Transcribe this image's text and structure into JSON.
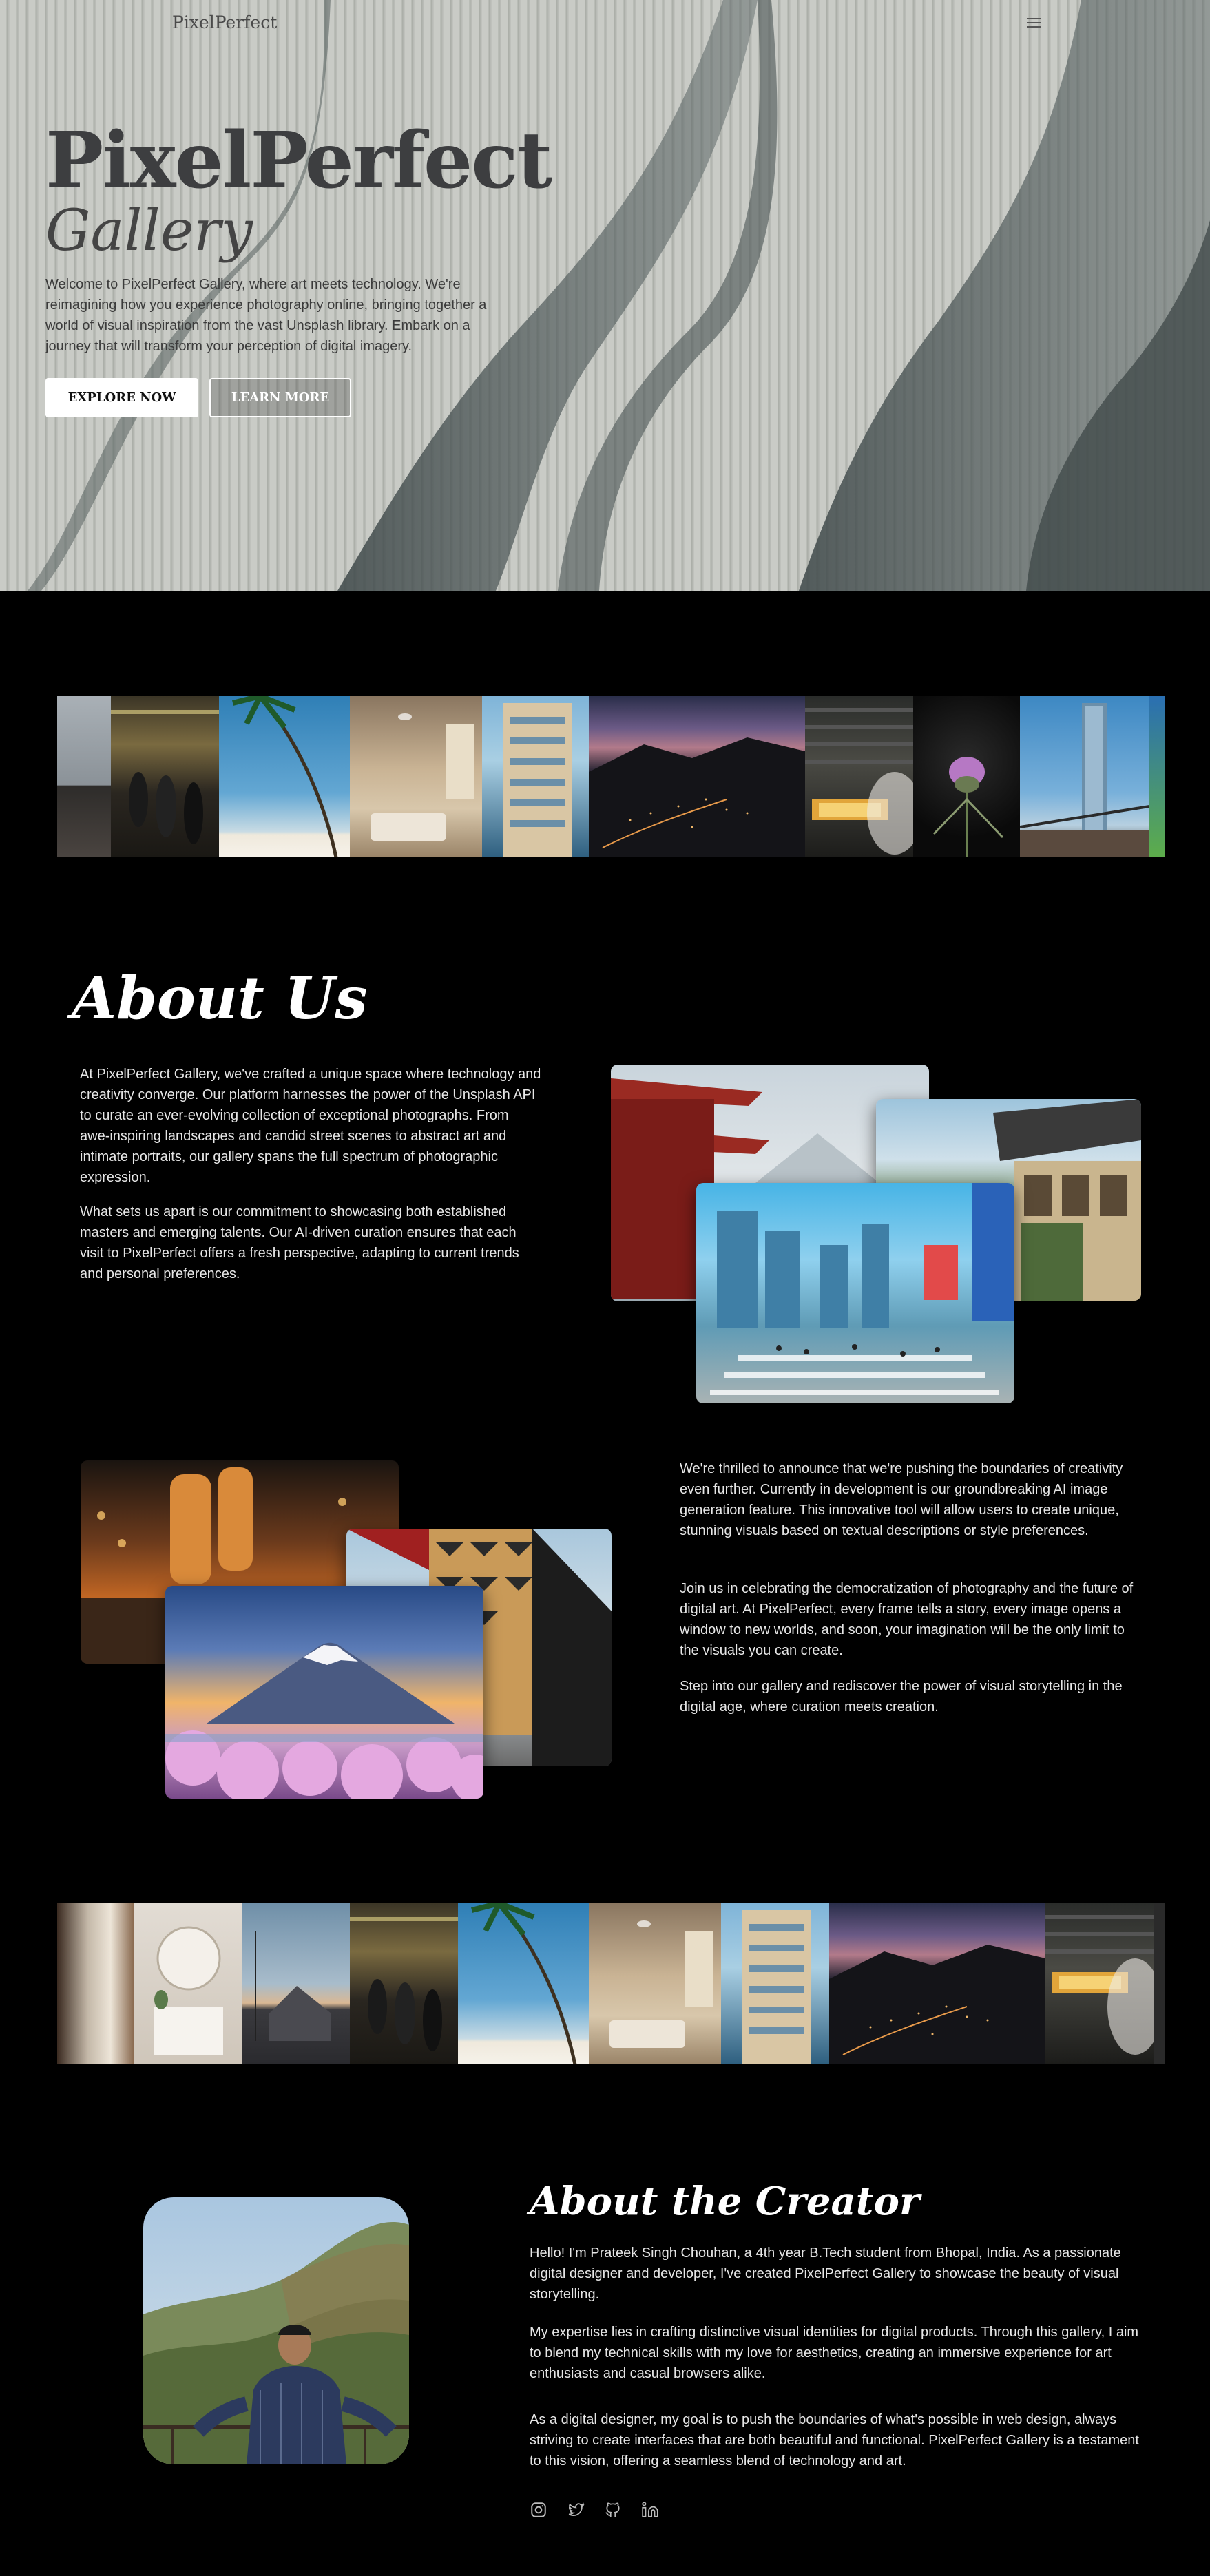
{
  "nav": {
    "logo": "PixelPerfect",
    "menu_icon": "hamburger-menu-icon"
  },
  "hero": {
    "title": "PixelPerfect",
    "subtitle": "Gallery",
    "description": "Welcome to PixelPerfect Gallery, where art meets technology. We're reimagining how you experience photography online, bringing together a world of visual inspiration from the vast Unsplash library. Embark on a journey that will transform your perception of digital imagery.",
    "explore_label": "EXPLORE NOW",
    "learn_label": "LEARN MORE"
  },
  "about": {
    "title": "About Us",
    "para1": "At PixelPerfect Gallery, we've crafted a unique space where technology and creativity converge. Our platform harnesses the power of the Unsplash API to curate an ever-evolving collection of exceptional photographs. From awe-inspiring landscapes and candid street scenes to abstract art and intimate portraits, our gallery spans the full spectrum of photographic expression.",
    "para2": "What sets us apart is our commitment to showcasing both established masters and emerging talents. Our AI-driven curation ensures that each visit to PixelPerfect offers a fresh perspective, adapting to current trends and personal preferences.",
    "para3": "We're thrilled to announce that we're pushing the boundaries of creativity even further. Currently in development is our groundbreaking AI image generation feature. This innovative tool will allow users to create unique, stunning visuals based on textual descriptions or style preferences.",
    "para4": "Join us in celebrating the democratization of photography and the future of digital art. At PixelPerfect, every frame tells a story, every image opens a window to new worlds, and soon, your imagination will be the only limit to the visuals you can create.",
    "para5": "Step into our gallery and rediscover the power of visual storytelling in the digital age, where curation meets creation."
  },
  "creator": {
    "title": "About the Creator",
    "para1": "Hello! I'm Prateek Singh Chouhan, a 4th year B.Tech student from Bhopal, India. As a passionate digital designer and developer, I've created PixelPerfect Gallery to showcase the beauty of visual storytelling.",
    "para2": "My expertise lies in crafting distinctive visual identities for digital products. Through this gallery, I aim to blend my technical skills with my love for aesthetics, creating an immersive experience for art enthusiasts and casual browsers alike.",
    "para3": "As a digital designer, my goal is to push the boundaries of what's possible in web design, always striving to create interfaces that are both beautiful and functional. PixelPerfect Gallery is a testament to this vision, offering a seamless blend of technology and art.",
    "socials": [
      "instagram-icon",
      "twitter-icon",
      "github-icon",
      "linkedin-icon"
    ]
  },
  "colors": {
    "hero_text": "#3d3e40",
    "background": "#000000",
    "body_text": "#e6e6e6"
  }
}
